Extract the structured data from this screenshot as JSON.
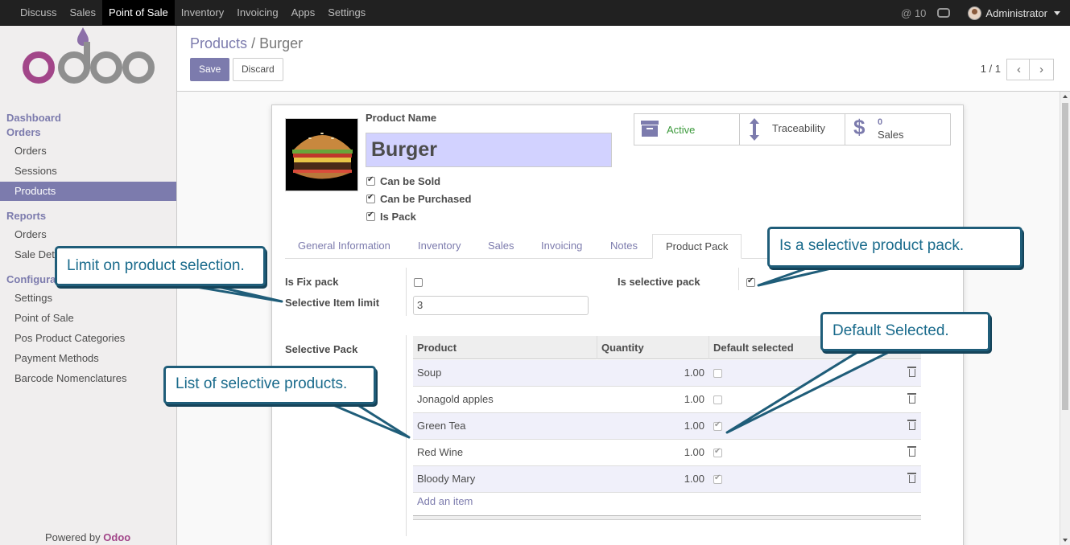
{
  "topbar": {
    "menu": [
      "Discuss",
      "Sales",
      "Point of Sale",
      "Inventory",
      "Invoicing",
      "Apps",
      "Settings"
    ],
    "active_menu": "Point of Sale",
    "messages": "@ 10",
    "user": "Administrator"
  },
  "sidebar": {
    "dashboard": "Dashboard",
    "orders_section": "Orders",
    "orders_items": [
      "Orders",
      "Sessions",
      "Products"
    ],
    "reports_section": "Reports",
    "reports_items": [
      "Orders",
      "Sale Details"
    ],
    "config_section": "Configuration",
    "config_items": [
      "Settings",
      "Point of Sale",
      "Pos Product Categories",
      "Payment Methods",
      "Barcode Nomenclatures"
    ],
    "powered_prefix": "Powered by",
    "powered_brand": "Odoo"
  },
  "control_panel": {
    "breadcrumb_parent": "Products",
    "breadcrumb_sep": "/",
    "breadcrumb_current": "Burger",
    "save_label": "Save",
    "discard_label": "Discard",
    "pager": "1 / 1"
  },
  "form": {
    "product_name_label": "Product Name",
    "product_name": "Burger",
    "can_be_sold": "Can be Sold",
    "can_be_purchased": "Can be Purchased",
    "is_pack": "Is Pack",
    "stat_active": "Active",
    "stat_traceability": "Traceability",
    "stat_sales_count": "0",
    "stat_sales_label": "Sales",
    "tabs": [
      "General Information",
      "Inventory",
      "Sales",
      "Invoicing",
      "Notes",
      "Product Pack"
    ],
    "active_tab": "Product Pack",
    "is_fix_pack_label": "Is Fix pack",
    "selective_limit_label": "Selective Item limit",
    "selective_limit_value": "3",
    "is_selective_pack_label": "Is selective pack",
    "selective_pack_label": "Selective Pack",
    "add_item": "Add an item"
  },
  "table": {
    "columns": [
      "Product",
      "Quantity",
      "Default selected"
    ],
    "rows": [
      {
        "product": "Soup",
        "quantity": "1.00",
        "default_selected": false
      },
      {
        "product": "Jonagold apples",
        "quantity": "1.00",
        "default_selected": false
      },
      {
        "product": "Green Tea",
        "quantity": "1.00",
        "default_selected": true
      },
      {
        "product": "Red Wine",
        "quantity": "1.00",
        "default_selected": true
      },
      {
        "product": "Bloody Mary",
        "quantity": "1.00",
        "default_selected": true
      }
    ]
  },
  "callouts": {
    "limit": "Limit on product selection.",
    "selective": "Is a selective product pack.",
    "default_selected": "Default Selected.",
    "list": "List of selective products."
  },
  "colors": {
    "accent": "#7c7bad",
    "brand": "#a24689",
    "callout_border": "#1f5d79",
    "callout_text": "#1a6b8c",
    "name_field_bg": "#d2d2ff",
    "active_green": "#3c9a3c"
  }
}
